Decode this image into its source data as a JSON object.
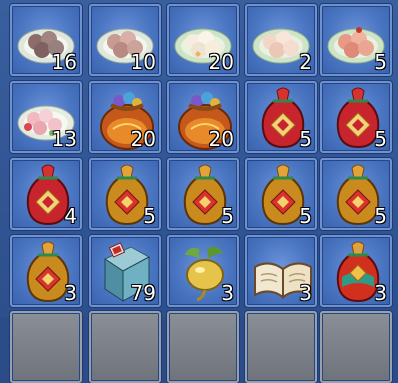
{
  "inventory": {
    "slots": [
      {
        "item_icon": "dumpling-plate-brown-icon",
        "count": "16"
      },
      {
        "item_icon": "dumpling-plate-pink-icon",
        "count": "10"
      },
      {
        "item_icon": "dumpling-plate-white-icon",
        "count": "20"
      },
      {
        "item_icon": "dumpling-plate-cream-icon",
        "count": "2"
      },
      {
        "item_icon": "dumpling-plate-red-icon",
        "count": "5"
      },
      {
        "item_icon": "dumpling-plate-flower-icon",
        "count": "13"
      },
      {
        "item_icon": "treasure-sack-orange-icon",
        "count": "20"
      },
      {
        "item_icon": "treasure-sack-orange-icon",
        "count": "20"
      },
      {
        "item_icon": "lucky-bag-red-icon",
        "count": "5"
      },
      {
        "item_icon": "lucky-bag-red-icon",
        "count": "5"
      },
      {
        "item_icon": "lucky-bag-red-icon",
        "count": "4"
      },
      {
        "item_icon": "lucky-bag-gold-icon",
        "count": "5"
      },
      {
        "item_icon": "lucky-bag-gold-icon",
        "count": "5"
      },
      {
        "item_icon": "lucky-bag-gold-icon",
        "count": "5"
      },
      {
        "item_icon": "lucky-bag-gold-icon",
        "count": "5"
      },
      {
        "item_icon": "lucky-bag-gold-icon",
        "count": "3"
      },
      {
        "item_icon": "blue-book-icon",
        "count": "79"
      },
      {
        "item_icon": "golden-radish-icon",
        "count": "3"
      },
      {
        "item_icon": "open-book-icon",
        "count": "3"
      },
      {
        "item_icon": "lucky-bag-colorful-icon",
        "count": "3"
      }
    ]
  }
}
